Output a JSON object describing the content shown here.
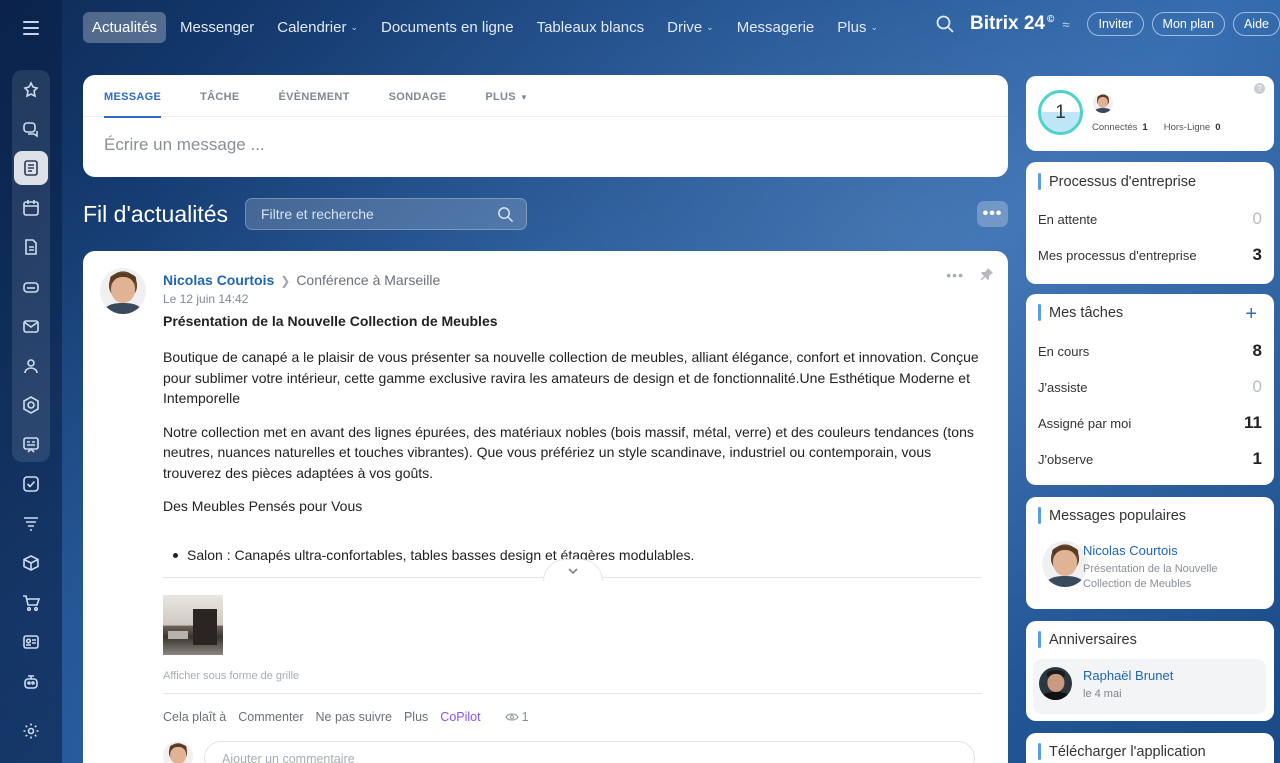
{
  "nav": {
    "items": [
      {
        "label": "Actualités",
        "dropdown": false
      },
      {
        "label": "Messenger",
        "dropdown": false
      },
      {
        "label": "Calendrier",
        "dropdown": true
      },
      {
        "label": "Documents en ligne",
        "dropdown": false
      },
      {
        "label": "Tableaux blancs",
        "dropdown": false
      },
      {
        "label": "Drive",
        "dropdown": true
      },
      {
        "label": "Messagerie",
        "dropdown": false
      },
      {
        "label": "Plus",
        "dropdown": true
      }
    ],
    "active_index": 0
  },
  "brand": {
    "name": "Bitrix 24",
    "mark": "©"
  },
  "top_buttons": {
    "invite": "Inviter",
    "plan": "Mon plan",
    "help": "Aide"
  },
  "composer": {
    "tabs": [
      "MESSAGE",
      "TÂCHE",
      "ÉVÈNEMENT",
      "SONDAGE",
      "PLUS"
    ],
    "placeholder": "Écrire un message ..."
  },
  "feed": {
    "title": "Fil d'actualités",
    "filter_placeholder": "Filtre et recherche",
    "more": "•••"
  },
  "post": {
    "author": "Nicolas Courtois",
    "destination": "Conférence à Marseille",
    "date": "Le 12 juin 14:42",
    "menu": "•••",
    "title": "Présentation de la Nouvelle Collection de Meubles",
    "paragraph1": "Boutique de canapé a le plaisir de vous présenter sa nouvelle collection de meubles, alliant élégance, confort et innovation. Conçue pour sublimer votre intérieur, cette gamme exclusive ravira les amateurs de design et de fonctionnalité.Une Esthétique Moderne et Intemporelle",
    "paragraph2": "Notre collection met en avant des lignes épurées, des matériaux nobles (bois massif, métal, verre) et des couleurs tendances (tons neutres, nuances naturelles et touches vibrantes). Que vous préfériez un style scandinave, industriel ou contemporain, vous trouverez des pièces adaptées à vos goûts.",
    "paragraph3": "Des Meubles Pensés pour Vous",
    "bullet1": "Salon : Canapés ultra-confortables, tables basses design et étagères modulables.",
    "grid_link": "Afficher sous forme de grille",
    "actions": {
      "like": "Cela plaît à",
      "comment": "Commenter",
      "unfollow": "Ne pas suivre",
      "more": "Plus",
      "copilot": "CoPilot",
      "views": "1"
    },
    "comment_placeholder": "Ajouter un commentaire"
  },
  "online": {
    "count": "1",
    "connected_label": "Connectés",
    "connected": "1",
    "offline_label": "Hors-Ligne",
    "offline": "0",
    "help": "?"
  },
  "processes": {
    "title": "Processus d'entreprise",
    "rows": [
      {
        "label": "En attente",
        "value": "0"
      },
      {
        "label": "Mes processus d'entreprise",
        "value": "3"
      }
    ]
  },
  "tasks": {
    "title": "Mes tâches",
    "add": "+",
    "rows": [
      {
        "label": "En cours",
        "value": "8"
      },
      {
        "label": "J'assiste",
        "value": "0"
      },
      {
        "label": "Assigné par moi",
        "value": "11"
      },
      {
        "label": "J'observe",
        "value": "1"
      }
    ]
  },
  "popular": {
    "title": "Messages populaires",
    "name": "Nicolas Courtois",
    "text": "Présentation de la Nouvelle Collection de Meubles"
  },
  "birthdays": {
    "title": "Anniversaires",
    "name": "Raphaël Brunet",
    "date": "le 4 mai"
  },
  "download": {
    "title": "Télécharger l'application"
  },
  "colors": {
    "accent": "#2e6bc5",
    "link": "#2067b0",
    "copilot": "#8e52ec",
    "online_ring": "#4dd3c9"
  },
  "icons": [
    "menu-icon",
    "copilot-icon",
    "chat-icon",
    "feed-icon",
    "calendar-icon",
    "document-icon",
    "drive-icon",
    "mail-icon",
    "groups-icon",
    "hexagon-icon",
    "board-icon",
    "tasks-icon",
    "funnel-icon",
    "box-icon",
    "cart-icon",
    "contact-icon",
    "robot-icon",
    "settings-icon"
  ]
}
